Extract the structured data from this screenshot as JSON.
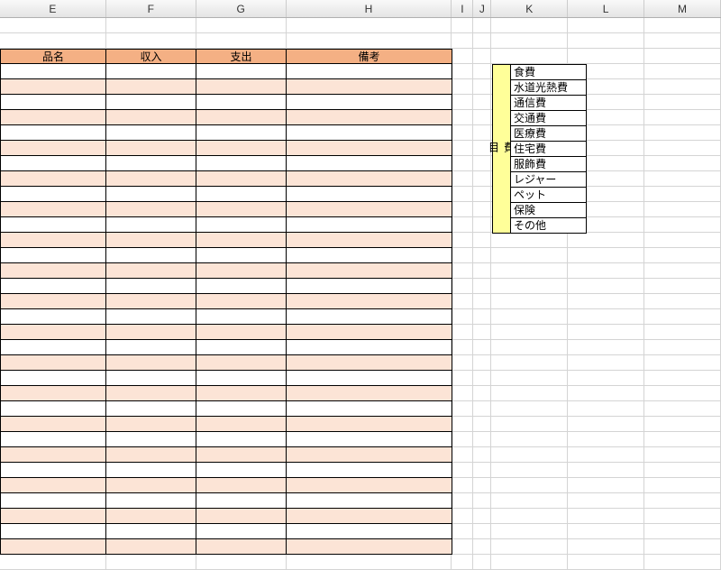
{
  "columns": [
    {
      "letter": "E",
      "width": 118
    },
    {
      "letter": "F",
      "width": 100
    },
    {
      "letter": "G",
      "width": 100
    },
    {
      "letter": "H",
      "width": 184
    },
    {
      "letter": "I",
      "width": 24
    },
    {
      "letter": "J",
      "width": 20
    },
    {
      "letter": "K",
      "width": 85
    },
    {
      "letter": "L",
      "width": 85
    },
    {
      "letter": "M",
      "width": 85
    }
  ],
  "main_table": {
    "headers": [
      "品名",
      "収入",
      "支出",
      "備考"
    ],
    "widths": [
      118,
      100,
      100,
      184
    ],
    "num_rows": 32
  },
  "side_table": {
    "label": "費目",
    "items": [
      "食費",
      "水道光熱費",
      "通信費",
      "交通費",
      "医療費",
      "住宅費",
      "服飾費",
      "レジャー",
      "ペット",
      "保険",
      "その他"
    ]
  }
}
